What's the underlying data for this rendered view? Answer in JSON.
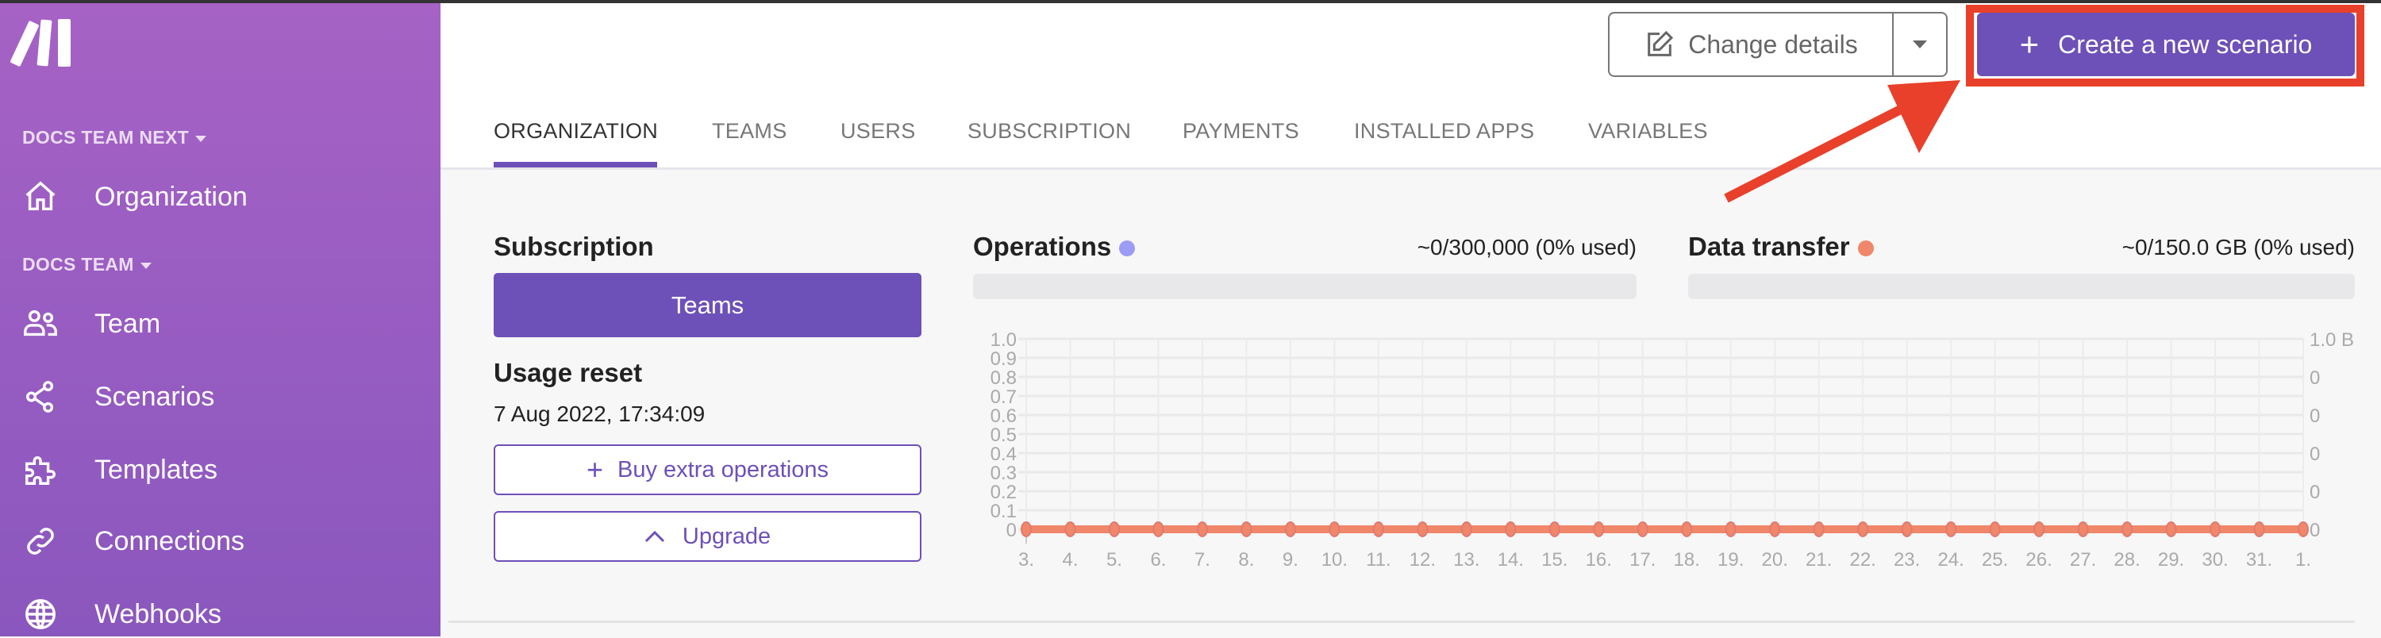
{
  "sidebar": {
    "logo": "make-logo",
    "sections": [
      {
        "label": "DOCS TEAM NEXT",
        "items": [
          {
            "label": "Organization",
            "icon": "house-icon"
          }
        ]
      },
      {
        "label": "DOCS TEAM",
        "items": [
          {
            "label": "Team",
            "icon": "users-icon"
          },
          {
            "label": "Scenarios",
            "icon": "share-nodes-icon"
          },
          {
            "label": "Templates",
            "icon": "puzzle-icon"
          },
          {
            "label": "Connections",
            "icon": "link-icon"
          },
          {
            "label": "Webhooks",
            "icon": "globe-icon"
          }
        ]
      }
    ]
  },
  "header": {
    "change_details": "Change details",
    "create_scenario": "Create a new scenario",
    "tabs": [
      "ORGANIZATION",
      "TEAMS",
      "USERS",
      "SUBSCRIPTION",
      "PAYMENTS",
      "INSTALLED APPS",
      "VARIABLES"
    ],
    "active_tab": "ORGANIZATION"
  },
  "annotation": {
    "color": "#e8402a"
  },
  "subscription": {
    "title": "Subscription",
    "plan": "Teams",
    "usage_reset_title": "Usage reset",
    "usage_reset_date": "7 Aug 2022, 17:34:09",
    "buy_extra": "Buy extra operations",
    "upgrade": "Upgrade"
  },
  "operations": {
    "title": "Operations",
    "usage": "~0/300,000 (0% used)",
    "color": "#9b9cf5",
    "fraction": 0
  },
  "data_transfer": {
    "title": "Data transfer",
    "usage": "~0/150.0 GB (0% used)",
    "color": "#f0876a",
    "fraction": 0
  },
  "colors": {
    "accent": "#6d50b8",
    "sidebar": "#9b5cc4"
  },
  "chart_data": {
    "type": "line",
    "categories": [
      "3.",
      "4.",
      "5.",
      "6.",
      "7.",
      "8.",
      "9.",
      "10.",
      "11.",
      "12.",
      "13.",
      "14.",
      "15.",
      "16.",
      "17.",
      "18.",
      "19.",
      "20.",
      "21.",
      "22.",
      "23.",
      "24.",
      "25.",
      "26.",
      "27.",
      "28.",
      "29.",
      "30.",
      "31.",
      "1."
    ],
    "series": [
      {
        "name": "Operations",
        "axis": "left",
        "color": "#9b9cf5",
        "values": [
          0,
          0,
          0,
          0,
          0,
          0,
          0,
          0,
          0,
          0,
          0,
          0,
          0,
          0,
          0,
          0,
          0,
          0,
          0,
          0,
          0,
          0,
          0,
          0,
          0,
          0,
          0,
          0,
          0,
          0
        ]
      },
      {
        "name": "Data transfer",
        "axis": "right",
        "color": "#f0876a",
        "values": [
          0,
          0,
          0,
          0,
          0,
          0,
          0,
          0,
          0,
          0,
          0,
          0,
          0,
          0,
          0,
          0,
          0,
          0,
          0,
          0,
          0,
          0,
          0,
          0,
          0,
          0,
          0,
          0,
          0,
          0
        ]
      }
    ],
    "ylim": [
      0,
      1.0
    ],
    "left_ticks": [
      "0",
      "0.1",
      "0.2",
      "0.3",
      "0.4",
      "0.5",
      "0.6",
      "0.7",
      "0.8",
      "0.9",
      "1.0"
    ],
    "right_ticks": [
      "0",
      "0",
      "0",
      "0",
      "0",
      "1.0 B"
    ],
    "grid": true
  }
}
